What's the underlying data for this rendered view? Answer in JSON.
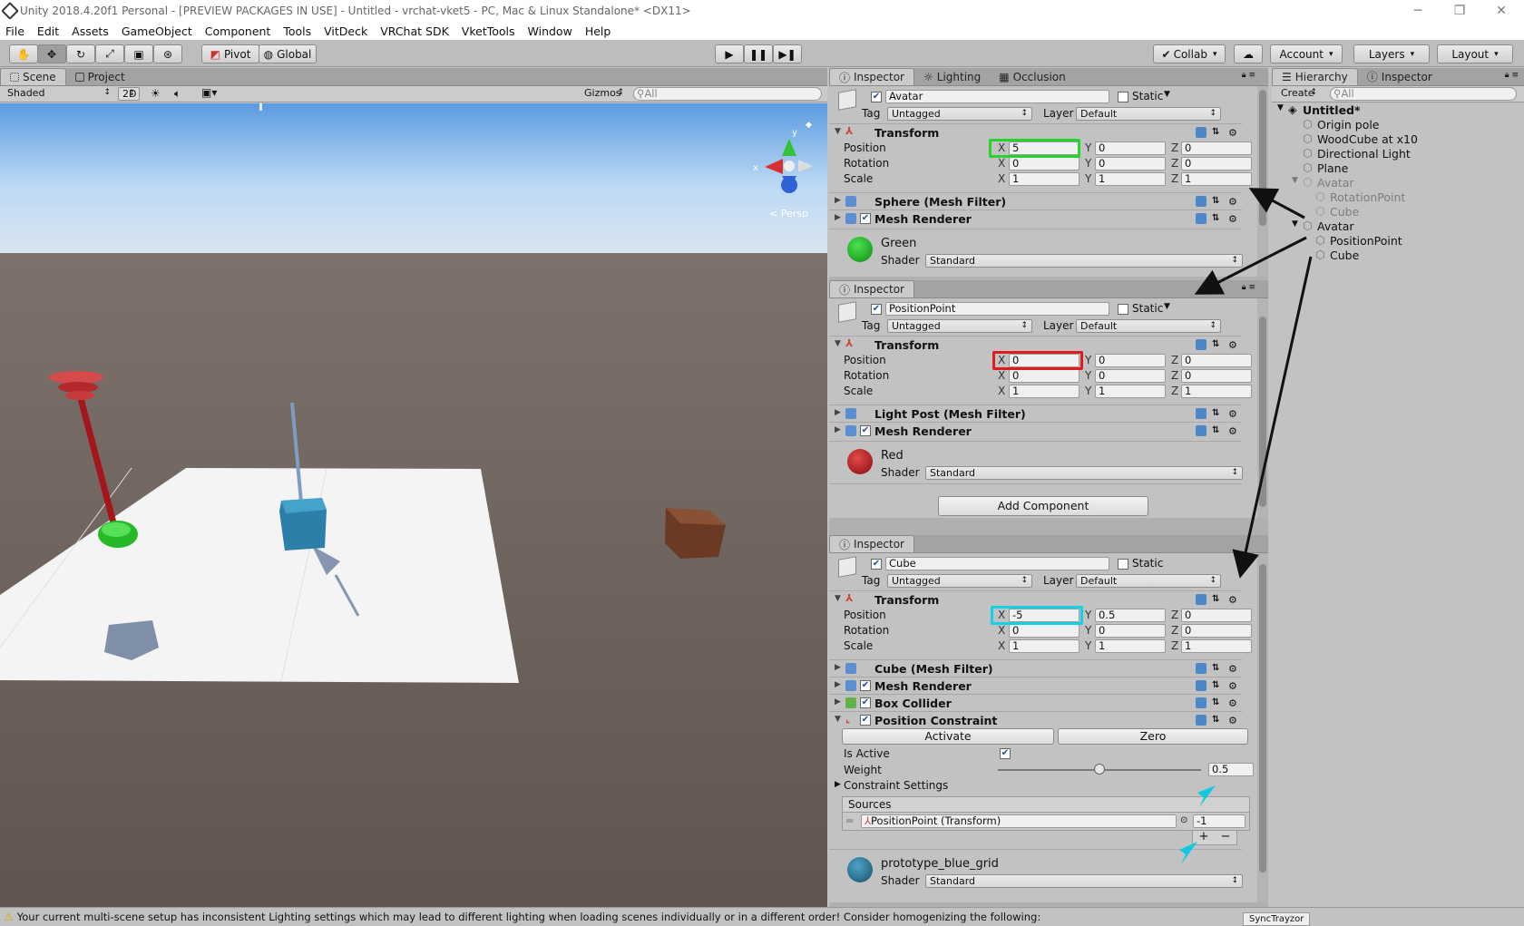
{
  "window": {
    "title": "Unity 2018.4.20f1 Personal - [PREVIEW PACKAGES IN USE] - Untitled - vrchat-vket5 - PC, Mac & Linux Standalone* <DX11>"
  },
  "menu": [
    "File",
    "Edit",
    "Assets",
    "GameObject",
    "Component",
    "Tools",
    "VitDeck",
    "VRChat SDK",
    "VketTools",
    "Window",
    "Help"
  ],
  "toolbar": {
    "pivot": "Pivot",
    "global": "Global",
    "collab": "Collab",
    "account": "Account",
    "layers": "Layers",
    "layout": "Layout"
  },
  "scene": {
    "tab_scene": "Scene",
    "tab_project": "Project",
    "shading": "Shaded",
    "mode_2d": "2D",
    "gizmos": "Gizmos",
    "search_placeholder": "All",
    "persp": "< Persp"
  },
  "inspector1": {
    "tabs": [
      "Inspector",
      "Lighting",
      "Occlusion"
    ],
    "name": "Avatar",
    "static": "Static",
    "tag_label": "Tag",
    "tag": "Untagged",
    "layer_label": "Layer",
    "layer": "Default",
    "transform": "Transform",
    "position_label": "Position",
    "rotation_label": "Rotation",
    "scale_label": "Scale",
    "pos": [
      "5",
      "0",
      "0"
    ],
    "rot": [
      "0",
      "0",
      "0"
    ],
    "scale": [
      "1",
      "1",
      "1"
    ],
    "comp1": "Sphere (Mesh Filter)",
    "comp2": "Mesh Renderer",
    "material": "Green",
    "shader_label": "Shader",
    "shader": "Standard"
  },
  "inspector2": {
    "tab": "Inspector",
    "name": "PositionPoint",
    "static": "Static",
    "tag_label": "Tag",
    "tag": "Untagged",
    "layer_label": "Layer",
    "layer": "Default",
    "transform": "Transform",
    "position_label": "Position",
    "rotation_label": "Rotation",
    "scale_label": "Scale",
    "pos": [
      "0",
      "0",
      "0"
    ],
    "rot": [
      "0",
      "0",
      "0"
    ],
    "scale": [
      "1",
      "1",
      "1"
    ],
    "comp1": "Light Post (Mesh Filter)",
    "comp2": "Mesh Renderer",
    "material": "Red",
    "shader_label": "Shader",
    "shader": "Standard",
    "add_component": "Add Component"
  },
  "inspector3": {
    "tab": "Inspector",
    "name": "Cube",
    "static": "Static",
    "tag_label": "Tag",
    "tag": "Untagged",
    "layer_label": "Layer",
    "layer": "Default",
    "transform": "Transform",
    "position_label": "Position",
    "rotation_label": "Rotation",
    "scale_label": "Scale",
    "pos": [
      "-5",
      "0.5",
      "0"
    ],
    "rot": [
      "0",
      "0",
      "0"
    ],
    "scale": [
      "1",
      "1",
      "1"
    ],
    "comp1": "Cube (Mesh Filter)",
    "comp2": "Mesh Renderer",
    "comp3": "Box Collider",
    "comp4": "Position Constraint",
    "activate": "Activate",
    "zero": "Zero",
    "is_active_label": "Is Active",
    "weight_label": "Weight",
    "weight": "0.5",
    "weight_fraction": 0.5,
    "constraint_settings": "Constraint Settings",
    "sources": "Sources",
    "source_item": "PositionPoint (Transform)",
    "source_weight": "-1",
    "material": "prototype_blue_grid",
    "shader_label": "Shader",
    "shader": "Standard"
  },
  "hierarchy": {
    "tabs": [
      "Hierarchy",
      "Inspector"
    ],
    "create": "Create",
    "search_placeholder": "All",
    "items": [
      {
        "label": "Untitled*"
      },
      {
        "label": "Origin pole"
      },
      {
        "label": "WoodCube at x10"
      },
      {
        "label": "Directional Light"
      },
      {
        "label": "Plane"
      },
      {
        "label": "Avatar"
      },
      {
        "label": "RotationPoint"
      },
      {
        "label": "Cube"
      },
      {
        "label": "Avatar"
      },
      {
        "label": "PositionPoint"
      },
      {
        "label": "Cube"
      }
    ]
  },
  "axes": {
    "x": "X",
    "y": "Y",
    "z": "Z"
  },
  "status": {
    "message": "Your current multi-scene setup has inconsistent Lighting settings which may lead to different lighting when loading scenes individually or in a different order! Consider homogenizing the following:",
    "tooltip": "SyncTrayzor"
  },
  "colors": {
    "highlight_green": "#27d32f",
    "highlight_red": "#e01b1b",
    "highlight_cyan": "#12d0e8",
    "arrow": "#111111"
  }
}
